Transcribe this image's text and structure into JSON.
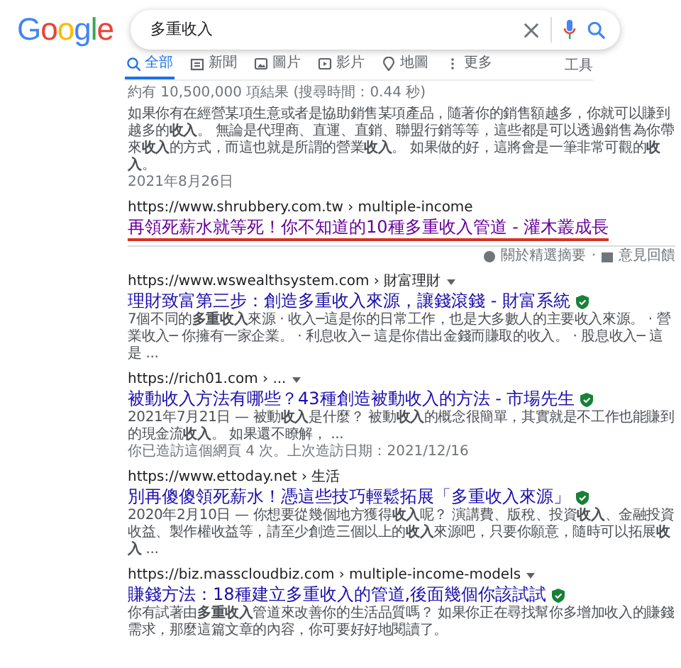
{
  "logo": "Google",
  "search": {
    "value": "多重收入"
  },
  "tabs": [
    {
      "label": "全部",
      "selected": true
    },
    {
      "label": "新聞",
      "selected": false
    },
    {
      "label": "圖片",
      "selected": false
    },
    {
      "label": "影片",
      "selected": false
    },
    {
      "label": "地圖",
      "selected": false
    },
    {
      "label": "更多",
      "selected": false
    }
  ],
  "tools": "工具",
  "stats": "約有 10,500,000 項結果 (搜尋時間：0.44 秒)",
  "featured": {
    "snippet": "如果你有在經營某項生意或者是協助銷售某項產品，隨著你的銷售額越多，你就可以賺到越多的**收入**。 無論是代理商、直運、直銷、聯盟行銷等等，這些都是可以透過銷售為你帶來**收入**的方式，而這也就是所謂的營業**收入**。 如果做的好，這將會是一筆非常可觀的**收入**。",
    "date": "2021年8月26日",
    "url": "https://www.shrubbery.com.tw › multiple-income",
    "title": "再領死薪水就等死！你不知道的10種多重收入管道 - 灌木叢成長",
    "about": "關於精選摘要",
    "sep": "·",
    "feedback": "意見回饋"
  },
  "results": [
    {
      "url": "https://www.wswealthsystem.com › 財富理財",
      "dropdown": true,
      "title": "理財致富第三步：創造多重收入來源，讓錢滾錢 - 財富系統",
      "snippet": "7個不同的**多重收入**來源 · 收入─這是你的日常工作，也是大多數人的主要收入來源。 · 營業收入─ 你擁有一家企業。 · 利息收入─ 這是你借出金錢而賺取的收入。 · 股息收入─ 這是 ..."
    },
    {
      "url": "https://rich01.com › ...",
      "dropdown": true,
      "title": "被動收入方法有哪些？43種創造被動收入的方法 - 市場先生",
      "snippet": "2021年7月21日 — 被動**收入**是什麼？ 被動**收入**的概念很簡單，其實就是不工作也能賺到的現金流**收入**。 如果還不瞭解， ...",
      "visited": "你已造訪這個網頁 4 次。上次造訪日期：2021/12/16"
    },
    {
      "url": "https://www.ettoday.net › 生活",
      "dropdown": false,
      "title": "別再傻傻領死薪水！憑這些技巧輕鬆拓展「多重收入來源」",
      "snippet": "2020年2月10日 — 你想要從幾個地方獲得**收入**呢？ 演講費、版稅、投資**收入**、金融投資收益、製作權收益等，請至少創造三個以上的**收入**來源吧，只要你願意，隨時可以拓展**收入** ..."
    },
    {
      "url": "https://biz.masscloudbiz.com › multiple-income-models",
      "dropdown": true,
      "title": "賺錢方法：18種建立多重收入的管道,後面幾個你該試試",
      "snippet": "你有試著由**多重收入**管道來改善你的生活品質嗎？ 如果你正在尋找幫你多增加收入的賺錢需求，那麼這篇文章的內容，你可要好好地閱讀了。"
    }
  ]
}
